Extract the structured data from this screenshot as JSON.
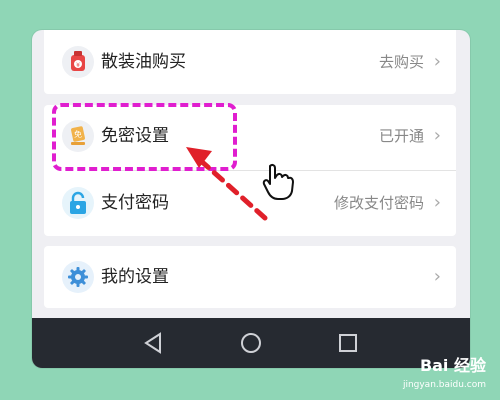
{
  "colors": {
    "background": "#8fd6b6",
    "highlight": "#e01ecf",
    "arrow": "#e0202a",
    "navbar": "#262a31"
  },
  "items": [
    {
      "icon": "oil-can-icon",
      "label": "散装油购买",
      "action": "去购买"
    },
    {
      "icon": "password-free-icon",
      "label": "免密设置",
      "action": "已开通"
    },
    {
      "icon": "lock-icon",
      "label": "支付密码",
      "action": "修改支付密码"
    },
    {
      "icon": "gear-icon",
      "label": "我的设置",
      "action": ""
    }
  ],
  "chevron": "›",
  "navbar": {
    "back_icon": "back-triangle-icon",
    "home_icon": "home-circle-icon",
    "recents_icon": "recents-square-icon"
  },
  "watermark": {
    "brand": "Bai 经验",
    "url": "jingyan.baidu.com"
  }
}
